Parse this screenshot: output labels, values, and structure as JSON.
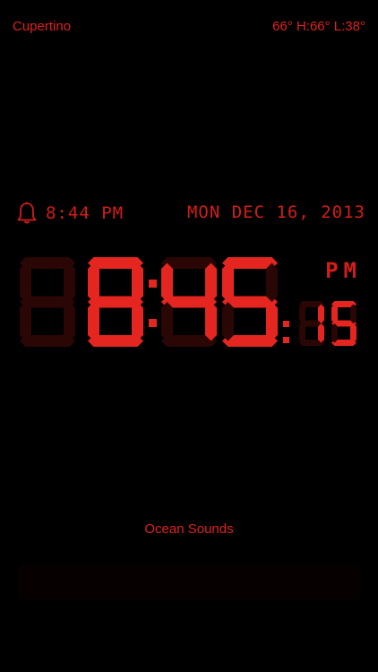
{
  "header": {
    "city": "Cupertino",
    "weather": "66° H:66° L:38°"
  },
  "alarm": {
    "time": "8:44 PM"
  },
  "date": "MON DEC 16, 2013",
  "clock": {
    "time": "8:45",
    "hours": "8",
    "minutes": "45",
    "seconds": "15",
    "meridiem": "PM"
  },
  "sound": {
    "label": "Ocean Sounds"
  },
  "icons": [
    "bell-icon"
  ],
  "colors": {
    "lcd_on": "#e5251f",
    "lcd_off": "#2a0605",
    "text": "#e0211d",
    "background": "#000000"
  }
}
